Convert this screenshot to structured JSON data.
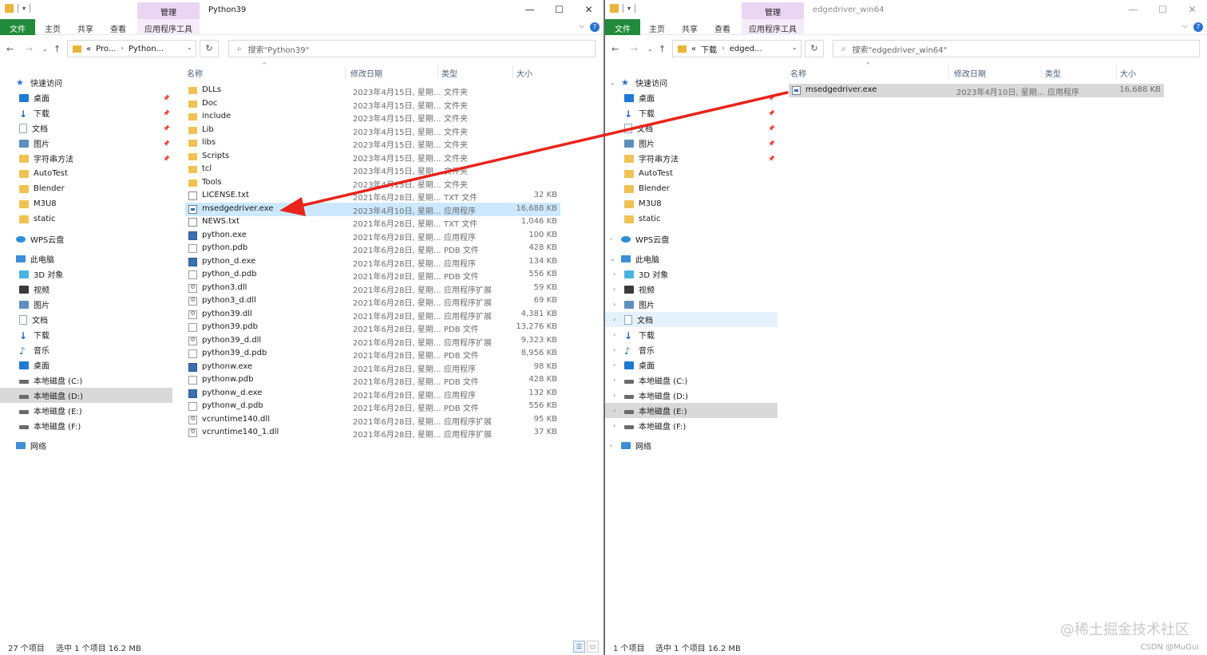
{
  "left": {
    "title": "Python39",
    "context_tab": "管理",
    "ribbon_tabs": [
      "文件",
      "主页",
      "共享",
      "查看",
      "应用程序工具"
    ],
    "address": {
      "prefix": "«",
      "crumbs": [
        "Pro...",
        "Python..."
      ]
    },
    "search_placeholder": "搜索\"Python39\"",
    "columns": {
      "name": "名称",
      "date": "修改日期",
      "type": "类型",
      "size": "大小"
    },
    "sidebar": [
      {
        "label": "快速访问",
        "icon": "star-icon"
      },
      {
        "label": "桌面",
        "icon": "desktop-icon",
        "pinned": true
      },
      {
        "label": "下载",
        "icon": "download-icon",
        "pinned": true
      },
      {
        "label": "文档",
        "icon": "document-icon",
        "pinned": true
      },
      {
        "label": "图片",
        "icon": "picture-icon",
        "pinned": true
      },
      {
        "label": "字符串方法",
        "icon": "folder-icon",
        "pinned": true
      },
      {
        "label": "AutoTest",
        "icon": "folder-icon"
      },
      {
        "label": "Blender",
        "icon": "folder-icon"
      },
      {
        "label": "M3U8",
        "icon": "folder-icon"
      },
      {
        "label": "static",
        "icon": "folder-icon"
      },
      {
        "label": "WPS云盘",
        "icon": "cloud-icon"
      },
      {
        "label": "此电脑",
        "icon": "pc-icon"
      },
      {
        "label": "3D 对象",
        "icon": "cube-icon"
      },
      {
        "label": "视频",
        "icon": "video-icon"
      },
      {
        "label": "图片",
        "icon": "picture-icon"
      },
      {
        "label": "文档",
        "icon": "document-icon"
      },
      {
        "label": "下载",
        "icon": "download-icon"
      },
      {
        "label": "音乐",
        "icon": "music-icon"
      },
      {
        "label": "桌面",
        "icon": "desktop-icon"
      },
      {
        "label": "本地磁盘 (C:)",
        "icon": "drive-icon"
      },
      {
        "label": "本地磁盘 (D:)",
        "icon": "drive-icon",
        "selected": true
      },
      {
        "label": "本地磁盘 (E:)",
        "icon": "drive-icon"
      },
      {
        "label": "本地磁盘 (F:)",
        "icon": "drive-icon"
      },
      {
        "label": "网络",
        "icon": "network-icon"
      }
    ],
    "files": [
      {
        "name": "DLLs",
        "date": "2023年4月15日, 星期...",
        "type": "文件夹",
        "size": "",
        "icon": "folder"
      },
      {
        "name": "Doc",
        "date": "2023年4月15日, 星期...",
        "type": "文件夹",
        "size": "",
        "icon": "folder"
      },
      {
        "name": "include",
        "date": "2023年4月15日, 星期...",
        "type": "文件夹",
        "size": "",
        "icon": "folder"
      },
      {
        "name": "Lib",
        "date": "2023年4月15日, 星期...",
        "type": "文件夹",
        "size": "",
        "icon": "folder"
      },
      {
        "name": "libs",
        "date": "2023年4月15日, 星期...",
        "type": "文件夹",
        "size": "",
        "icon": "folder"
      },
      {
        "name": "Scripts",
        "date": "2023年4月15日, 星期...",
        "type": "文件夹",
        "size": "",
        "icon": "folder"
      },
      {
        "name": "tcl",
        "date": "2023年4月15日, 星期...",
        "type": "文件夹",
        "size": "",
        "icon": "folder"
      },
      {
        "name": "Tools",
        "date": "2023年4月15日, 星期...",
        "type": "文件夹",
        "size": "",
        "icon": "folder"
      },
      {
        "name": "LICENSE.txt",
        "date": "2021年6月28日, 星期...",
        "type": "TXT 文件",
        "size": "32 KB",
        "icon": "txt"
      },
      {
        "name": "msedgedriver.exe",
        "date": "2023年4月10日, 星期...",
        "type": "应用程序",
        "size": "16,688 KB",
        "icon": "exe",
        "selected": true
      },
      {
        "name": "NEWS.txt",
        "date": "2021年6月28日, 星期...",
        "type": "TXT 文件",
        "size": "1,046 KB",
        "icon": "txt"
      },
      {
        "name": "python.exe",
        "date": "2021年6月28日, 星期...",
        "type": "应用程序",
        "size": "100 KB",
        "icon": "py"
      },
      {
        "name": "python.pdb",
        "date": "2021年6月28日, 星期...",
        "type": "PDB 文件",
        "size": "428 KB",
        "icon": "pdb"
      },
      {
        "name": "python_d.exe",
        "date": "2021年6月28日, 星期...",
        "type": "应用程序",
        "size": "134 KB",
        "icon": "py"
      },
      {
        "name": "python_d.pdb",
        "date": "2021年6月28日, 星期...",
        "type": "PDB 文件",
        "size": "556 KB",
        "icon": "pdb"
      },
      {
        "name": "python3.dll",
        "date": "2021年6月28日, 星期...",
        "type": "应用程序扩展",
        "size": "59 KB",
        "icon": "dll"
      },
      {
        "name": "python3_d.dll",
        "date": "2021年6月28日, 星期...",
        "type": "应用程序扩展",
        "size": "69 KB",
        "icon": "dll"
      },
      {
        "name": "python39.dll",
        "date": "2021年6月28日, 星期...",
        "type": "应用程序扩展",
        "size": "4,381 KB",
        "icon": "dll"
      },
      {
        "name": "python39.pdb",
        "date": "2021年6月28日, 星期...",
        "type": "PDB 文件",
        "size": "13,276 KB",
        "icon": "pdb"
      },
      {
        "name": "python39_d.dll",
        "date": "2021年6月28日, 星期...",
        "type": "应用程序扩展",
        "size": "9,323 KB",
        "icon": "dll"
      },
      {
        "name": "python39_d.pdb",
        "date": "2021年6月28日, 星期...",
        "type": "PDB 文件",
        "size": "8,956 KB",
        "icon": "pdb"
      },
      {
        "name": "pythonw.exe",
        "date": "2021年6月28日, 星期...",
        "type": "应用程序",
        "size": "98 KB",
        "icon": "py"
      },
      {
        "name": "pythonw.pdb",
        "date": "2021年6月28日, 星期...",
        "type": "PDB 文件",
        "size": "428 KB",
        "icon": "pdb"
      },
      {
        "name": "pythonw_d.exe",
        "date": "2021年6月28日, 星期...",
        "type": "应用程序",
        "size": "132 KB",
        "icon": "py"
      },
      {
        "name": "pythonw_d.pdb",
        "date": "2021年6月28日, 星期...",
        "type": "PDB 文件",
        "size": "556 KB",
        "icon": "pdb"
      },
      {
        "name": "vcruntime140.dll",
        "date": "2021年6月28日, 星期...",
        "type": "应用程序扩展",
        "size": "95 KB",
        "icon": "dll"
      },
      {
        "name": "vcruntime140_1.dll",
        "date": "2021年6月28日, 星期...",
        "type": "应用程序扩展",
        "size": "37 KB",
        "icon": "dll"
      }
    ],
    "status": {
      "count": "27 个项目",
      "selection": "选中 1 个项目  16.2 MB"
    }
  },
  "right": {
    "title": "edgedriver_win64",
    "context_tab": "管理",
    "ribbon_tabs": [
      "文件",
      "主页",
      "共享",
      "查看",
      "应用程序工具"
    ],
    "address": {
      "prefix": "«",
      "crumbs": [
        "下载",
        "edged..."
      ]
    },
    "search_placeholder": "搜索\"edgedriver_win64\"",
    "columns": {
      "name": "名称",
      "date": "修改日期",
      "type": "类型",
      "size": "大小"
    },
    "sidebar": [
      {
        "label": "快速访问",
        "icon": "star-icon"
      },
      {
        "label": "桌面",
        "icon": "desktop-icon",
        "pinned": true
      },
      {
        "label": "下载",
        "icon": "download-icon",
        "pinned": true
      },
      {
        "label": "文档",
        "icon": "document-icon",
        "pinned": true
      },
      {
        "label": "图片",
        "icon": "picture-icon",
        "pinned": true
      },
      {
        "label": "字符串方法",
        "icon": "folder-icon",
        "pinned": true
      },
      {
        "label": "AutoTest",
        "icon": "folder-icon"
      },
      {
        "label": "Blender",
        "icon": "folder-icon"
      },
      {
        "label": "M3U8",
        "icon": "folder-icon"
      },
      {
        "label": "static",
        "icon": "folder-icon"
      },
      {
        "label": "WPS云盘",
        "icon": "cloud-icon"
      },
      {
        "label": "此电脑",
        "icon": "pc-icon"
      },
      {
        "label": "3D 对象",
        "icon": "cube-icon"
      },
      {
        "label": "视频",
        "icon": "video-icon"
      },
      {
        "label": "图片",
        "icon": "picture-icon"
      },
      {
        "label": "文档",
        "icon": "document-icon",
        "hover": true
      },
      {
        "label": "下载",
        "icon": "download-icon"
      },
      {
        "label": "音乐",
        "icon": "music-icon"
      },
      {
        "label": "桌面",
        "icon": "desktop-icon"
      },
      {
        "label": "本地磁盘 (C:)",
        "icon": "drive-icon"
      },
      {
        "label": "本地磁盘 (D:)",
        "icon": "drive-icon"
      },
      {
        "label": "本地磁盘 (E:)",
        "icon": "drive-icon",
        "selected": true
      },
      {
        "label": "本地磁盘 (F:)",
        "icon": "drive-icon"
      },
      {
        "label": "网络",
        "icon": "network-icon"
      }
    ],
    "files": [
      {
        "name": "msedgedriver.exe",
        "date": "2023年4月10日, 星期...",
        "type": "应用程序",
        "size": "16,688 KB",
        "icon": "exe",
        "selected": true
      }
    ],
    "status": {
      "count": "1 个项目",
      "selection": "选中 1 个项目  16.2 MB"
    }
  },
  "watermark": "@稀土掘金技术社区",
  "watermark_small": "CSDN @MuGui",
  "colors": {
    "file_tab": "#1f8b3b",
    "context_tab": "#ead6f3",
    "selection": "#cce8ff",
    "arrow": "#e8241c"
  }
}
